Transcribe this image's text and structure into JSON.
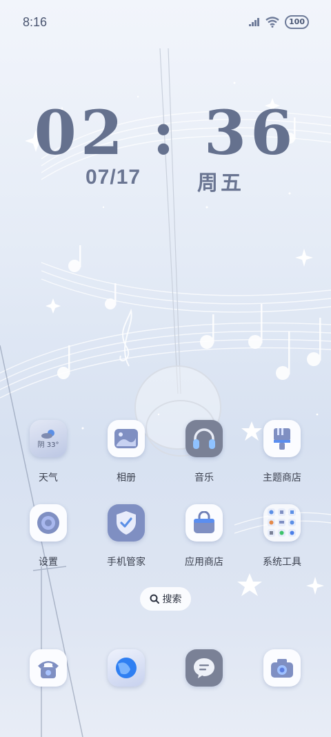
{
  "status_bar": {
    "time": "8:16",
    "battery": "100"
  },
  "lockscreen": {
    "clock": "02 : 36",
    "date": "07/17",
    "weekday": "周五"
  },
  "apps": [
    {
      "label": "天气",
      "icon": "weather-icon",
      "widget_text": "阴 33°"
    },
    {
      "label": "相册",
      "icon": "gallery-icon"
    },
    {
      "label": "音乐",
      "icon": "headphones-icon"
    },
    {
      "label": "主题商店",
      "icon": "brush-icon"
    },
    {
      "label": "设置",
      "icon": "gear-icon"
    },
    {
      "label": "手机管家",
      "icon": "shield-check-icon"
    },
    {
      "label": "应用商店",
      "icon": "shopping-bag-icon"
    },
    {
      "label": "系统工具",
      "icon": "folder-icon"
    }
  ],
  "search": {
    "label": "搜索"
  },
  "dock": [
    {
      "icon": "phone-icon"
    },
    {
      "icon": "browser-icon"
    },
    {
      "icon": "message-icon"
    },
    {
      "icon": "camera-icon"
    }
  ]
}
